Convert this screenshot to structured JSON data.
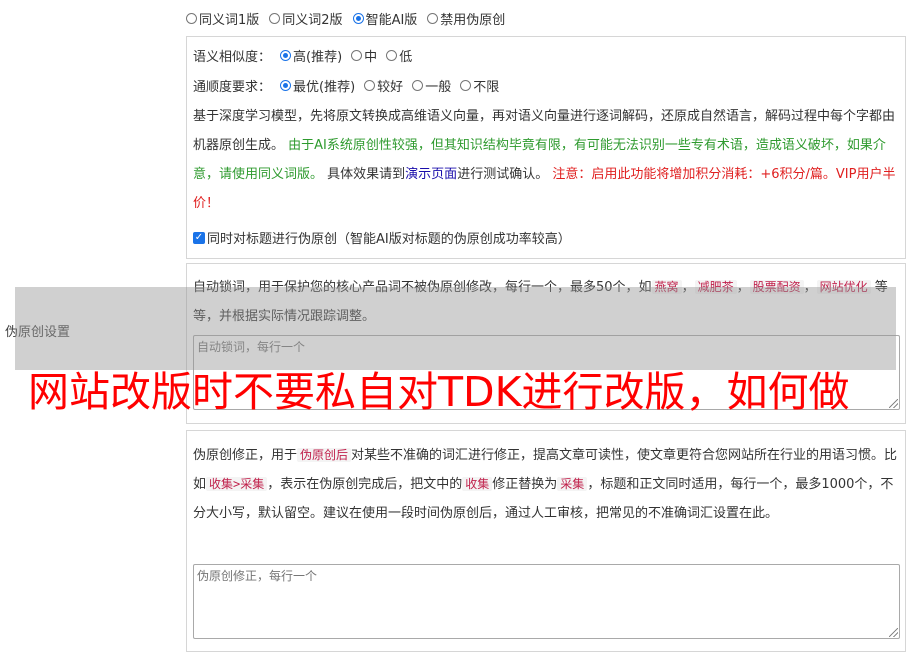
{
  "mode_options": [
    {
      "label": "同义词1版",
      "selected": false
    },
    {
      "label": "同义词2版",
      "selected": false
    },
    {
      "label": "智能AI版",
      "selected": true
    },
    {
      "label": "禁用伪原创",
      "selected": false
    }
  ],
  "similarity": {
    "label": "语义相似度：",
    "options": [
      {
        "label": "高(推荐)",
        "selected": true
      },
      {
        "label": "中",
        "selected": false
      },
      {
        "label": "低",
        "selected": false
      }
    ]
  },
  "fluency": {
    "label": "通顺度要求：",
    "options": [
      {
        "label": "最优(推荐)",
        "selected": true
      },
      {
        "label": "较好",
        "selected": false
      },
      {
        "label": "一般",
        "selected": false
      },
      {
        "label": "不限",
        "selected": false
      }
    ]
  },
  "ai_description": {
    "intro": "基于深度学习模型，先将原文转换成高维语义向量，再对语义向量进行逐词解码，还原成自然语言，解码过程中每个字都由机器原创生成。",
    "warning_green": "由于AI系统原创性较强，但其知识结构毕竟有限，有可能无法识别一些专有术语，造成语义破坏，如果介意，请使用同义词版。",
    "effect_prefix": "具体效果请到",
    "demo_link": "演示页面",
    "effect_suffix": "进行测试确认。",
    "notice_red": "注意：启用此功能将增加积分消耗：+6积分/篇。VIP用户半价！"
  },
  "title_checkbox": {
    "label": "同时对标题进行伪原创（智能AI版对标题的伪原创成功率较高）",
    "checked": true
  },
  "lock_words": {
    "intro": "自动锁词，用于保护您的核心产品词不被伪原创修改，每行一个，最多50个，如",
    "examples": [
      "燕窝",
      "减肥茶",
      "股票配资",
      "网站优化"
    ],
    "separator": "，",
    "outro": "等等，并根据实际情况跟踪调整。",
    "placeholder": "自动锁词，每行一个"
  },
  "correction": {
    "text1": "伪原创修正，用于",
    "tag1": "伪原创后",
    "text2": "对某些不准确的词汇进行修正，提高文章可读性，使文章更符合您网站所在行业的用语习惯。比如",
    "tag2": "收集>采集",
    "text3": "，表示在伪原创完成后，把文中的",
    "tag3": "收集",
    "text4": "修正替换为",
    "tag4": "采集",
    "text5": "，标题和正文同时适用，每行一个，最多1000个，不分大小写，默认留空。建议在使用一段时间伪原创后，通过人工审核，把常见的不准确词汇设置在此。",
    "placeholder": "伪原创修正，每行一个"
  },
  "settings_label": "伪原创设置",
  "overlay_title": "网站改版时不要私自对TDK进行改版，如何做"
}
